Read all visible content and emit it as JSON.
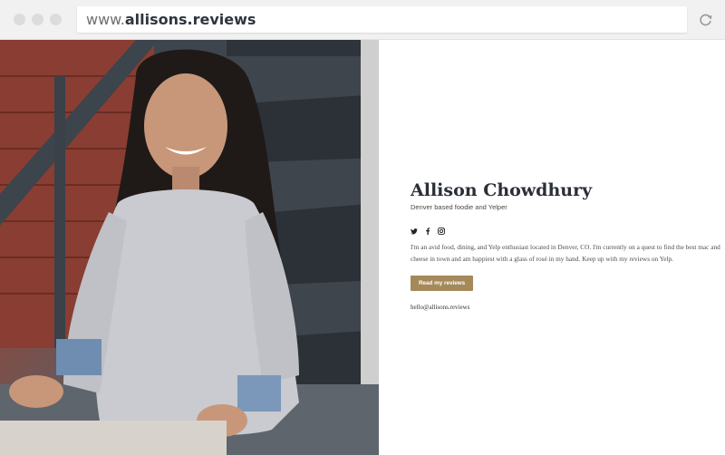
{
  "browser": {
    "url_prefix": "www.",
    "url_host": "allisons.reviews"
  },
  "profile": {
    "name": "Allison Chowdhury",
    "tagline": "Denver based foodie and Yelper",
    "bio": "I'm an avid food, dining, and Yelp enthusiast located in Denver, CO. I'm currently on a quest to find the best mac and cheese in town and am happiest with a glass of rosé in my hand. Keep up with my reviews on Yelp.",
    "cta_label": "Read my reviews",
    "email": "hello@allisons.reviews"
  },
  "social": [
    "twitter-icon",
    "facebook-icon",
    "instagram-icon"
  ],
  "colors": {
    "accent": "#a4895a",
    "chrome": "#f1f1f1"
  }
}
